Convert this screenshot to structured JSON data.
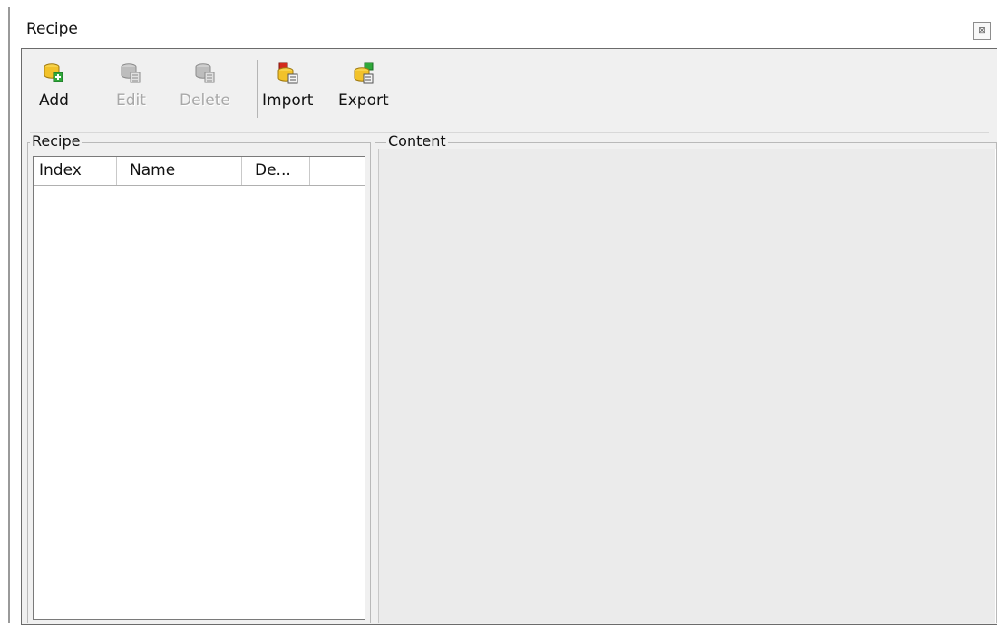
{
  "window": {
    "title": "Recipe",
    "close_glyph": "⊠"
  },
  "toolbar": {
    "buttons": [
      {
        "label": "Add",
        "icon": "add-recipe-icon",
        "enabled": true
      },
      {
        "label": "Edit",
        "icon": "edit-recipe-icon",
        "enabled": false
      },
      {
        "label": "Delete",
        "icon": "delete-recipe-icon",
        "enabled": false
      },
      {
        "label": "Import",
        "icon": "import-recipe-icon",
        "enabled": true
      },
      {
        "label": "Export",
        "icon": "export-recipe-icon",
        "enabled": true
      }
    ]
  },
  "recipe_group": {
    "title": "Recipe",
    "columns": [
      "Index",
      "Name",
      "De...",
      ""
    ],
    "rows": []
  },
  "content_group": {
    "title": "Content"
  },
  "colors": {
    "db_yellow": "#f2c22a",
    "add_green": "#2fa83a",
    "import_red": "#d42a1c",
    "disabled_gray": "#a8a8a8"
  }
}
